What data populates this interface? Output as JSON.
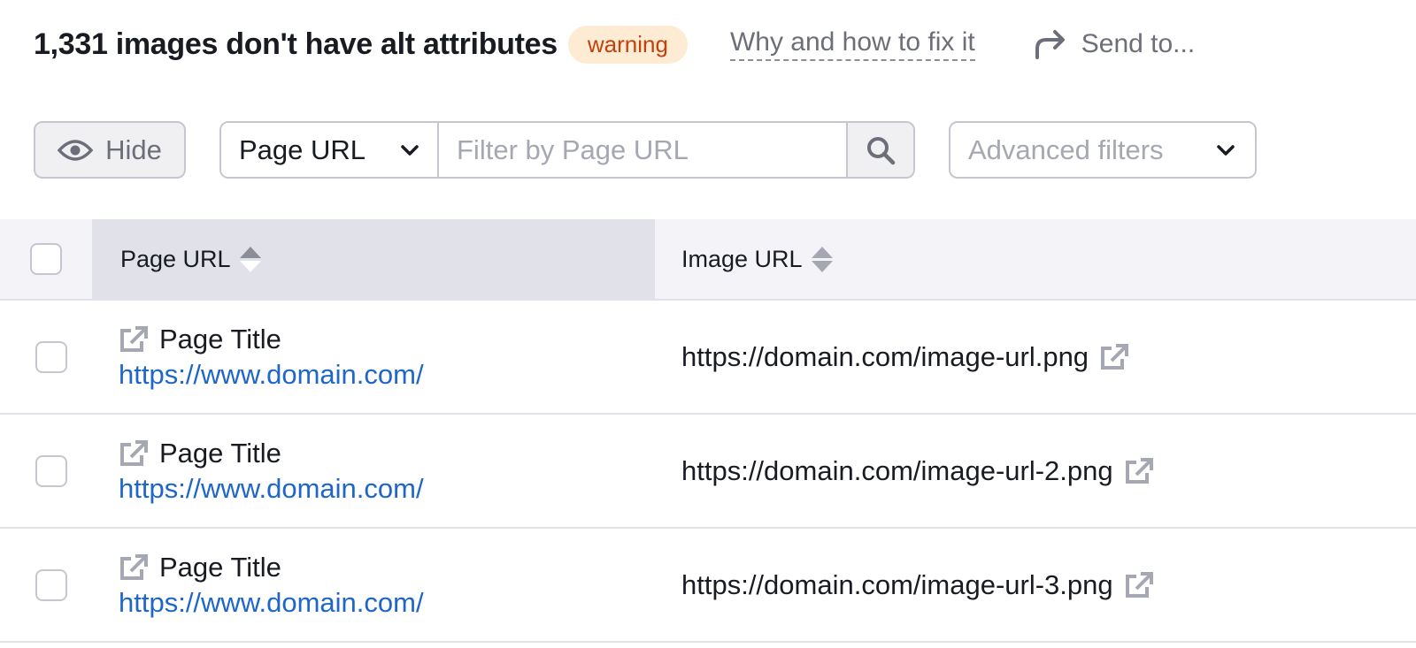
{
  "header": {
    "title": "1,331 images don't have alt attributes",
    "badge": "warning",
    "why_link": "Why and how to fix it",
    "send_to": "Send to...",
    "icons": {
      "send": "share-arrow-icon"
    }
  },
  "toolbar": {
    "hide_label": "Hide",
    "filter_select_value": "Page URL",
    "filter_placeholder": "Filter by Page URL",
    "filter_value": "",
    "advanced_filters_label": "Advanced filters",
    "icons": {
      "hide": "eye-icon",
      "search": "search-icon",
      "chevron": "chevron-down-icon"
    }
  },
  "table": {
    "columns": [
      {
        "label": "Page URL",
        "sorted": true
      },
      {
        "label": "Image URL",
        "sorted": false
      }
    ],
    "rows": [
      {
        "page_title": "Page Title",
        "page_url": "https://www.domain.com/",
        "image_url": "https://domain.com/image-url.png"
      },
      {
        "page_title": "Page Title",
        "page_url": "https://www.domain.com/",
        "image_url": "https://domain.com/image-url-2.png"
      },
      {
        "page_title": "Page Title",
        "page_url": "https://www.domain.com/",
        "image_url": "https://domain.com/image-url-3.png"
      }
    ]
  },
  "colors": {
    "title": "#191b23",
    "badge_bg": "#fdebd3",
    "badge_text": "#c4410b",
    "muted_text": "#6c6e79",
    "link": "#1e66c8",
    "border": "#c4c7cf",
    "header_bg": "#f4f4f8",
    "sorted_header_bg": "#e0e1e9"
  }
}
